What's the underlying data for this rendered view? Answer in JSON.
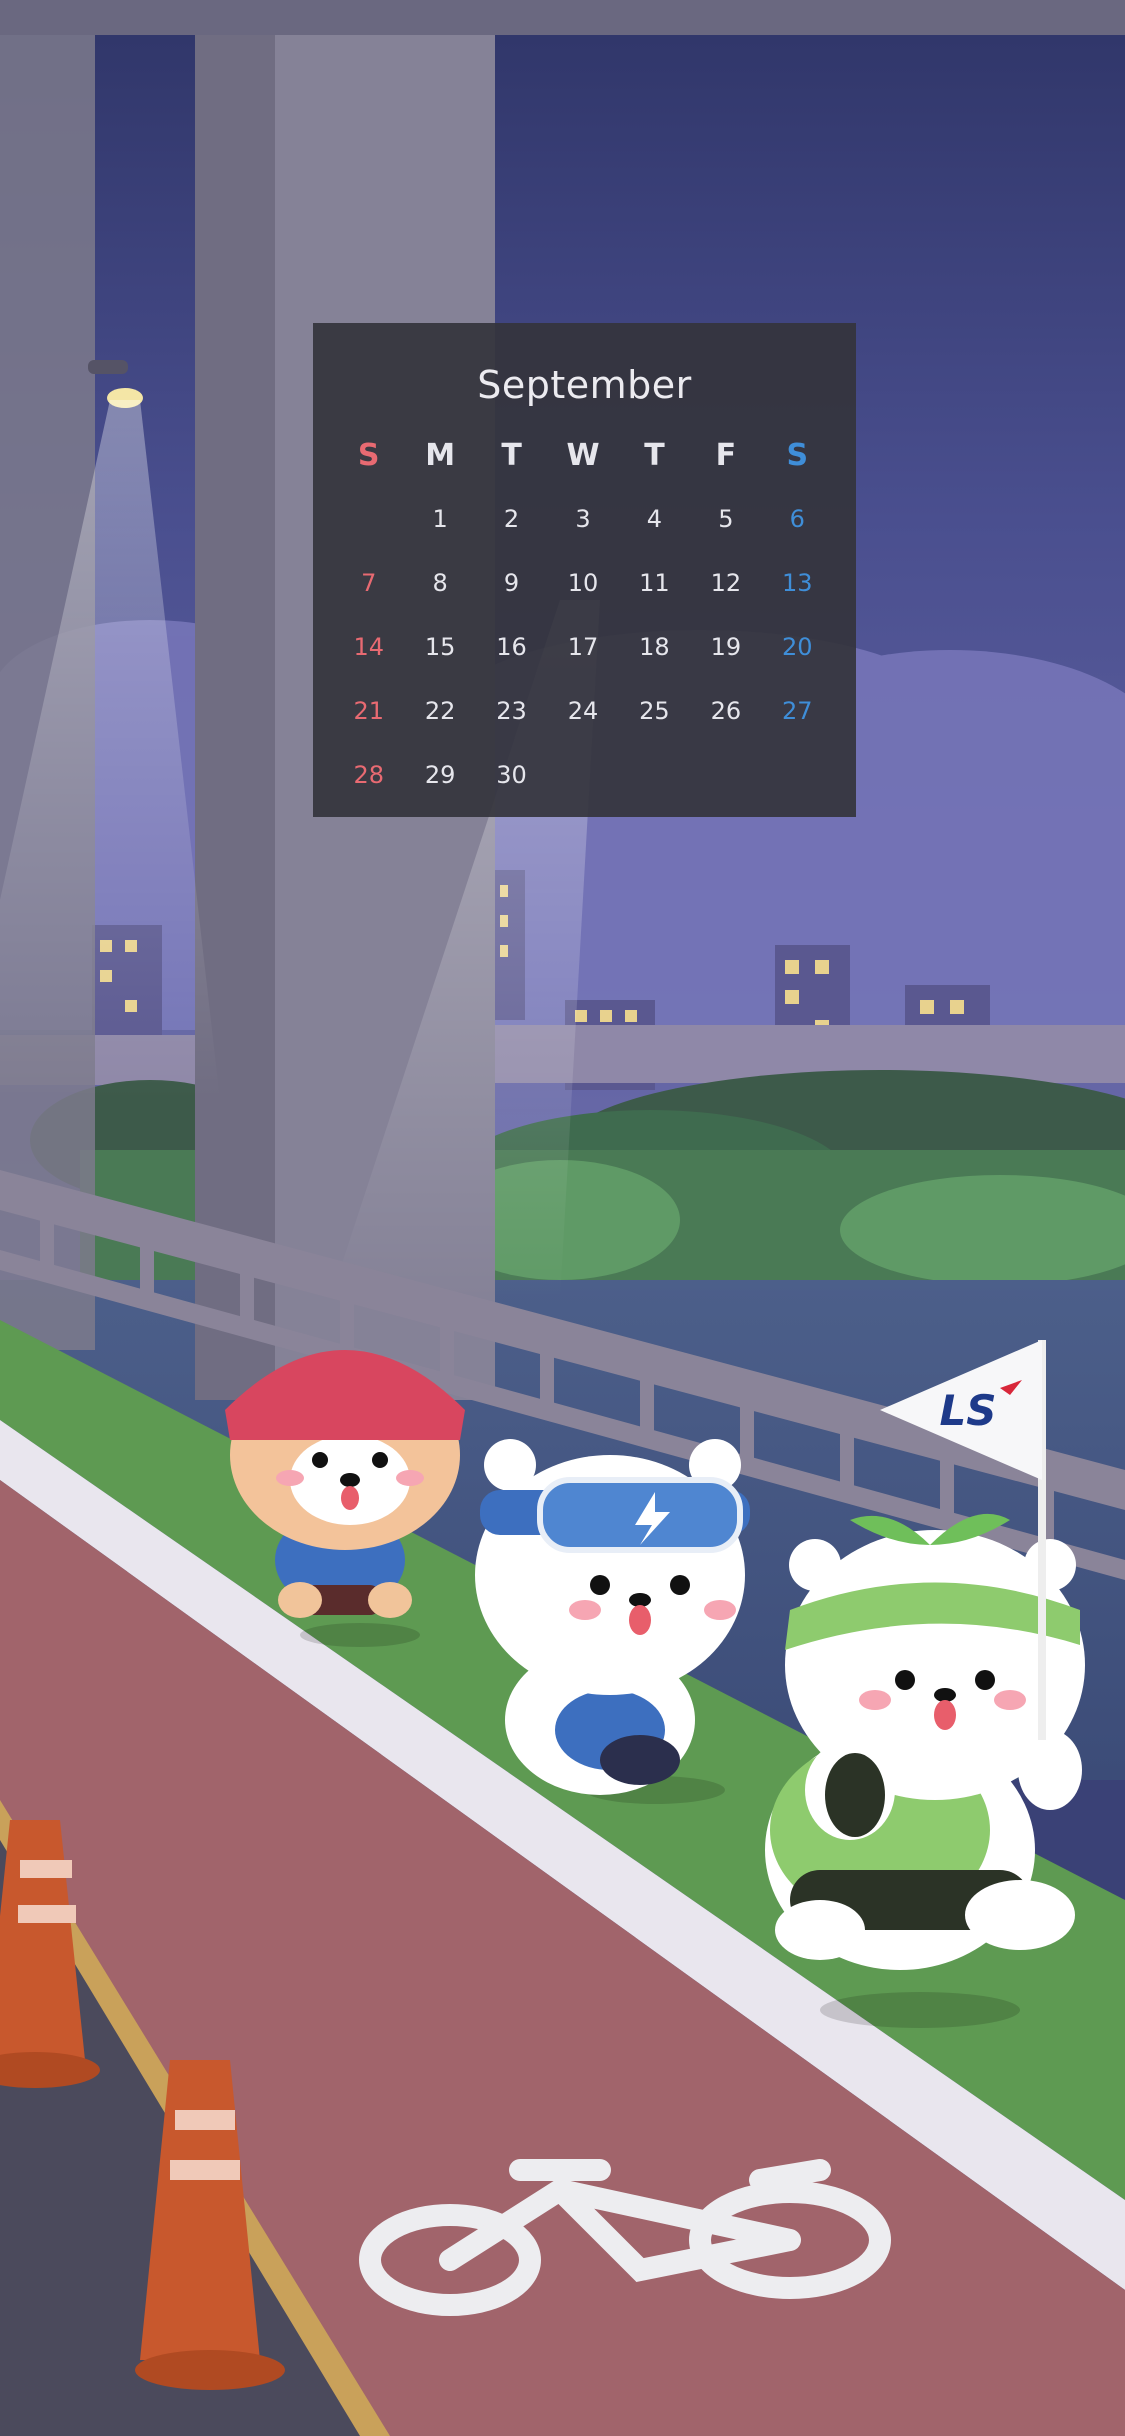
{
  "calendar": {
    "month": "September",
    "weekdays": [
      "S",
      "M",
      "T",
      "W",
      "T",
      "F",
      "S"
    ],
    "weeks": [
      [
        "",
        "1",
        "2",
        "3",
        "4",
        "5",
        "6"
      ],
      [
        "7",
        "8",
        "9",
        "10",
        "11",
        "12",
        "13"
      ],
      [
        "14",
        "15",
        "16",
        "17",
        "18",
        "19",
        "20"
      ],
      [
        "21",
        "22",
        "23",
        "24",
        "25",
        "26",
        "27"
      ],
      [
        "28",
        "29",
        "30",
        "",
        "",
        "",
        ""
      ]
    ],
    "colors": {
      "sunday": "#e86a72",
      "saturday": "#3f8ed8",
      "weekday": "#e6e6ec",
      "panel": "#34343c"
    }
  },
  "flag": {
    "logo_text": "LS"
  },
  "illustration": {
    "characters": [
      "puppy-red-cap-character",
      "white-bear-goggles-character",
      "white-bear-sprout-character"
    ],
    "icons": [
      "bicycle-icon",
      "traffic-cone-icon",
      "lightning-icon",
      "street-lamp-icon"
    ]
  }
}
